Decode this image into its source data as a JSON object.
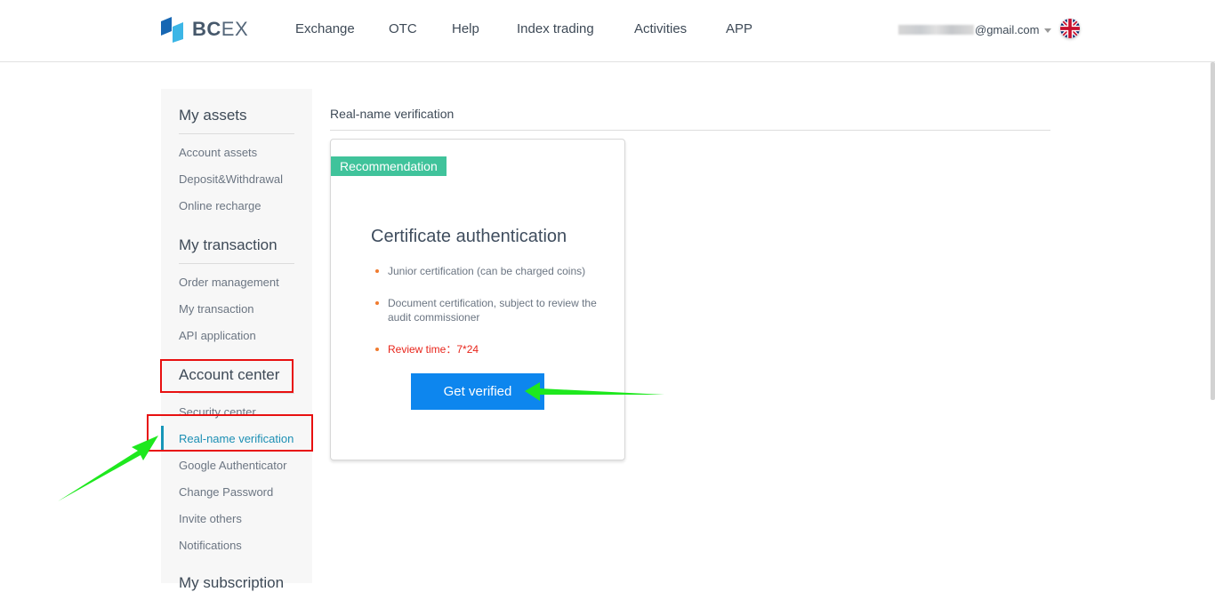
{
  "header": {
    "logo_text_bold": "BC",
    "logo_text_light": "EX",
    "nav": [
      {
        "label": "Exchange"
      },
      {
        "label": "OTC"
      },
      {
        "label": "Help"
      },
      {
        "label": "Index trading"
      },
      {
        "label": "Activities"
      },
      {
        "label": "APP"
      }
    ],
    "user_email_suffix": "@gmail.com",
    "language_icon": "uk-flag-icon"
  },
  "sidebar": {
    "sections": [
      {
        "title": "My assets",
        "items": [
          "Account assets",
          "Deposit&Withdrawal",
          "Online recharge"
        ]
      },
      {
        "title": "My transaction",
        "items": [
          "Order management",
          "My transaction",
          "API application"
        ]
      },
      {
        "title": "Account center",
        "items": [
          "Security center",
          "Real-name verification",
          "Google Authenticator",
          "Change Password",
          "Invite others",
          "Notifications"
        ]
      },
      {
        "title": "My subscription",
        "items": []
      }
    ],
    "active_item": "Real-name verification"
  },
  "main": {
    "title": "Real-name verification",
    "card": {
      "badge": "Recommendation",
      "title": "Certificate authentication",
      "bullets": [
        "Junior certification (can be charged coins)",
        "Document certification, subject to review the audit commissioner",
        "Review time：7*24"
      ],
      "button_label": "Get verified"
    }
  },
  "colors": {
    "accent_blue": "#0d86ee",
    "badge_green": "#40c39b",
    "active_teal": "#1796b8",
    "warning_red": "#e8241a",
    "annotation_red": "#e81010",
    "annotation_green": "#1ee81e"
  }
}
